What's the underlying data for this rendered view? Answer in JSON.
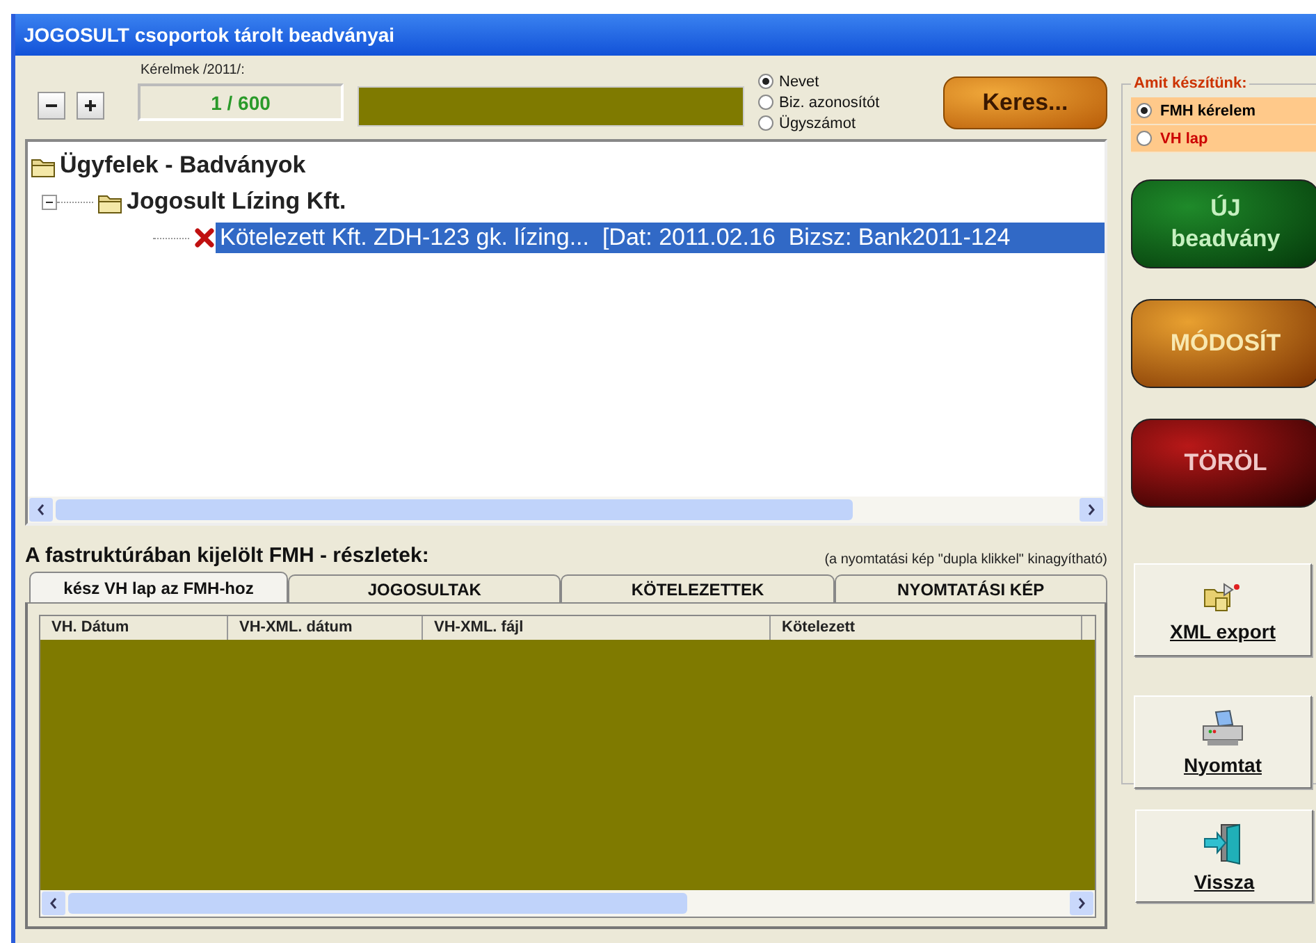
{
  "window": {
    "title": "JOGOSULT csoportok tárolt beadványai"
  },
  "counter": {
    "label": "Kérelmek  /2011/:",
    "value": "1 / 600"
  },
  "zoom_buttons": [
    {
      "kind": "minus"
    },
    {
      "kind": "plus"
    }
  ],
  "search_by": [
    {
      "label": "Nevet",
      "selected": true
    },
    {
      "label": "Biz. azonosítót",
      "selected": false
    },
    {
      "label": "Ügyszámot",
      "selected": false
    }
  ],
  "search_button": "Keres...",
  "tree": [
    {
      "label": "Ügyfelek - Badványok",
      "kind": "folder",
      "selected": false,
      "children": [
        {
          "label": "Jogosult Lízing Kft.",
          "kind": "folder",
          "selected": false,
          "expanded": true,
          "children": [
            {
              "label": "Kötelezett Kft. ZDH-123 gk. lízing...  [Dat: 2011.02.16  Bizsz: Bank2011-124",
              "kind": "deleted",
              "selected": true
            }
          ]
        }
      ]
    }
  ],
  "details": {
    "title": "A fastruktúrában kijelölt FMH - részletek:",
    "note": "(a nyomtatási kép \"dupla klikkel\" kinagyítható)"
  },
  "tabs": [
    {
      "label": "kész VH lap az FMH-hoz",
      "selected": true
    },
    {
      "label": "JOGOSULTAK",
      "selected": false
    },
    {
      "label": "KÖTELEZETTEK",
      "selected": false
    },
    {
      "label": "NYOMTATÁSI KÉP",
      "selected": false
    }
  ],
  "table": {
    "columns": [
      "VH. Dátum",
      "VH-XML. dátum",
      "VH-XML. fájl",
      "Kötelezett"
    ]
  },
  "doc_type": {
    "title": "Amit készítünk:",
    "options": [
      {
        "label": "FMH kérelem",
        "selected": true,
        "color": "#000000"
      },
      {
        "label": "VH lap",
        "selected": false,
        "color": "#cc0000"
      }
    ]
  },
  "actions": [
    {
      "label": "ÚJ\nbeadvány",
      "kind": "green"
    },
    {
      "label": "MÓDOSÍT",
      "kind": "orange"
    },
    {
      "label": "TÖRÖL",
      "kind": "red"
    },
    {
      "label": "XML export",
      "kind": "export"
    },
    {
      "label": "Nyomtat",
      "kind": "print"
    }
  ],
  "back_button": {
    "label": "Vissza",
    "kind": "exit"
  }
}
